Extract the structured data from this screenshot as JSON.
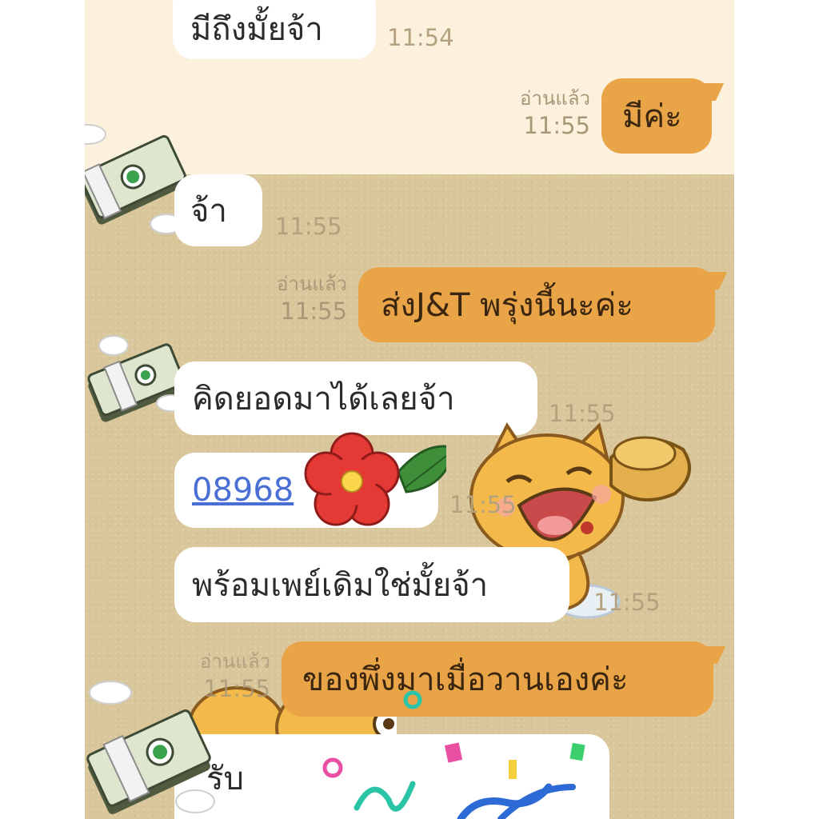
{
  "chat": {
    "messages": [
      {
        "dir": "in",
        "text": "มีถึงมั้ยจ้า",
        "time": "11:54"
      },
      {
        "dir": "out",
        "text": "มีค่ะ",
        "read": "อ่านแล้ว",
        "time": "11:55"
      },
      {
        "dir": "in",
        "text": "จ้า",
        "time": "11:55"
      },
      {
        "dir": "out",
        "text": "ส่งJ&T พรุ่งนี้นะค่ะ",
        "read": "อ่านแล้ว",
        "time": "11:55"
      },
      {
        "dir": "in",
        "text": "คิดยอดมาได้เลยจ้า",
        "time": "11:55"
      },
      {
        "dir": "in",
        "text": "08968",
        "link": true,
        "time": "11:55"
      },
      {
        "dir": "in",
        "text": "พร้อมเพย์เดิมใช่มั้ยจ้า",
        "time": "11:55"
      },
      {
        "dir": "out",
        "text": "ของพึ่งมาเมื่อวานเองค่ะ",
        "read": "อ่านแล้ว",
        "time": "11:55"
      },
      {
        "dir": "in",
        "text": "รับ"
      }
    ]
  },
  "colors": {
    "outgoing": "#e9a447",
    "incoming": "#ffffff",
    "background": "#d9c79b",
    "top_band": "#fcf1dd",
    "link": "#4a6fd4"
  },
  "icons": [
    "money-stack-icon",
    "red-flower-sticker",
    "tiger-sticker",
    "confetti-sticker"
  ]
}
